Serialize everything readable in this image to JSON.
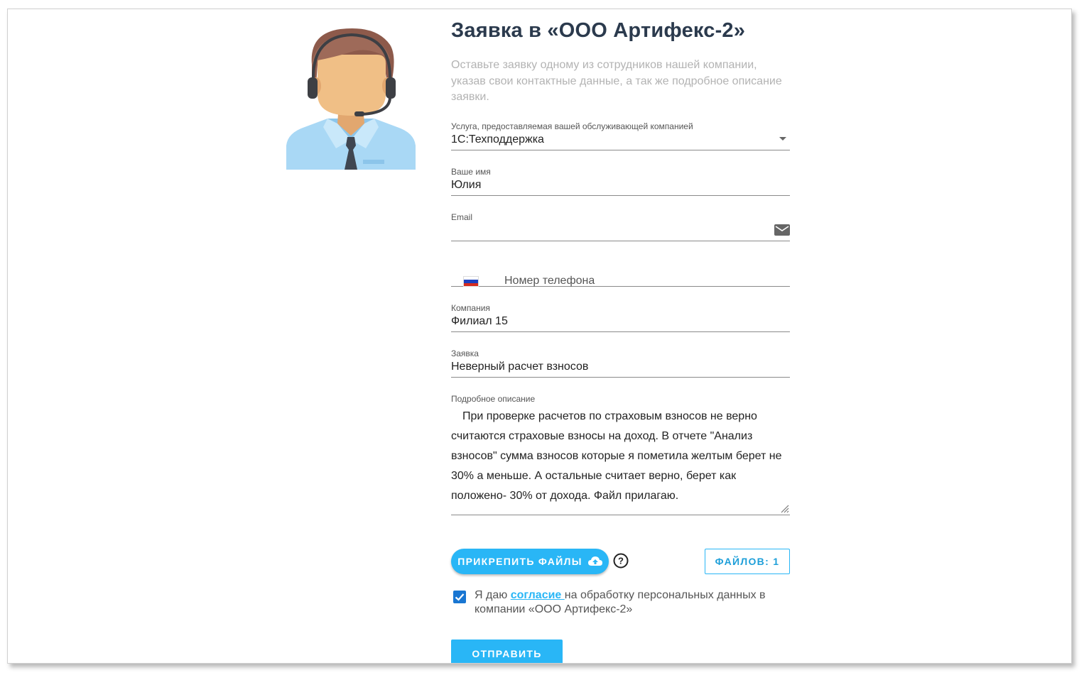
{
  "header": {
    "title": "Заявка в «ООО Артифекс-2»",
    "subtitle": "Оставьте заявку одному из сотрудников нашей компании, указав свои контактные данные, а так же подробное описание заявки."
  },
  "form": {
    "service": {
      "label": "Услуга, предоставляемая вашей обслуживающей компанией",
      "value": "1С:Техподдержка"
    },
    "name": {
      "label": "Ваше имя",
      "value": "Юлия"
    },
    "email": {
      "label": "Email",
      "value": "",
      "icon": "envelope-icon"
    },
    "phone": {
      "placeholder": "Номер телефона",
      "flag": "russia-flag-icon"
    },
    "company": {
      "label": "Компания",
      "value": "Филиал 15"
    },
    "request": {
      "label": "Заявка",
      "value": "Неверный расчет взносов"
    },
    "description": {
      "label": "Подробное описание",
      "value": "При проверке расчетов по страховым взносов не верно считаются страховые взносы на доход. В отчете \"Анализ взносов\" сумма взносов которые я пометила желтым берет не 30% а меньше. А остальные считает верно, берет как положено- 30% от дохода. Файл прилагаю."
    }
  },
  "actions": {
    "attach_label": "ПРИКРЕПИТЬ ФАЙЛЫ",
    "attach_icon": "cloud-upload-icon",
    "help_icon": "help-circle-icon",
    "files_label": "ФАЙЛОВ: 1",
    "submit_label": "ОТПРАВИТЬ"
  },
  "consent": {
    "checked": true,
    "prefix": "Я даю ",
    "link": "согласие ",
    "suffix": "на обработку персональных данных в компании «ООО Артифекс-2»"
  },
  "colors": {
    "accent": "#29b6f6",
    "checkbox": "#1976d2",
    "title": "#2b3a4d",
    "subtitle": "#b3b3b3"
  }
}
